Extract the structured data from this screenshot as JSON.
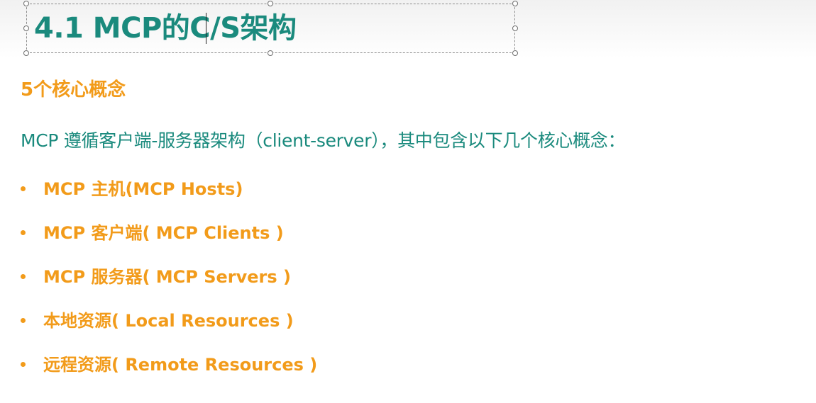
{
  "slide": {
    "title": "4.1 MCP的C/S架构",
    "subtitle": "5个核心概念",
    "intro": "MCP 遵循客户端-服务器架构（client-server），其中包含以下几个核心概念：",
    "concepts": [
      {
        "label": "MCP 主机(MCP Hosts)"
      },
      {
        "label": "MCP 客户端( MCP Clients )"
      },
      {
        "label": "MCP 服务器( MCP Servers )"
      },
      {
        "label": "本地资源( Local Resources )"
      },
      {
        "label": "远程资源( Remote Resources )"
      }
    ]
  },
  "colors": {
    "title_teal": "#1a8a7d",
    "accent_orange": "#f29b1a",
    "body_teal": "#1a8a7d"
  }
}
